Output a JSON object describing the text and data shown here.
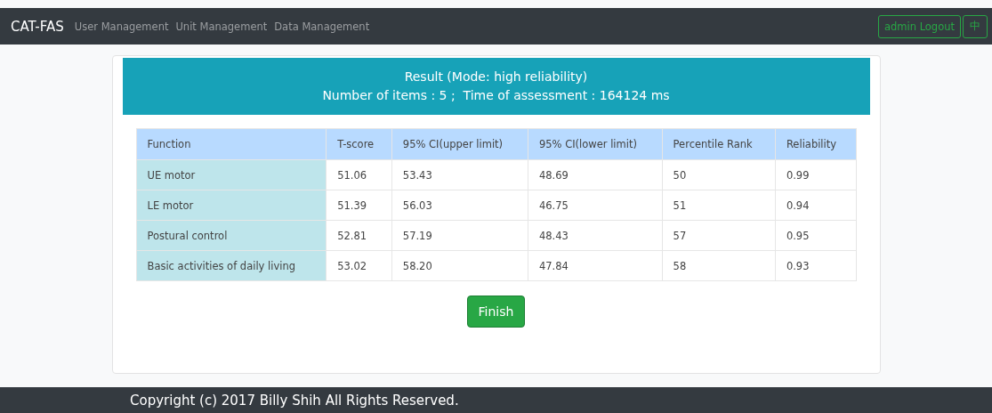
{
  "navbar": {
    "brand": "CAT-FAS",
    "links": [
      "User Management",
      "Unit Management",
      "Data Management"
    ],
    "buttons": [
      "admin Logout",
      "中"
    ]
  },
  "result": {
    "title": "Result (Mode: high reliability)",
    "summary": "Number of items : 5 ;  Time of assessment : 164124 ms"
  },
  "table": {
    "columns": [
      "Function",
      "T-score",
      "95% CI(upper limit)",
      "95% CI(lower limit)",
      "Percentile Rank",
      "Reliability"
    ],
    "rows": [
      [
        "UE motor",
        "51.06",
        "53.43",
        "48.69",
        "50",
        "0.99"
      ],
      [
        "LE motor",
        "51.39",
        "56.03",
        "46.75",
        "51",
        "0.94"
      ],
      [
        "Postural control",
        "52.81",
        "57.19",
        "48.43",
        "57",
        "0.95"
      ],
      [
        "Basic activities of daily living",
        "53.02",
        "58.20",
        "47.84",
        "58",
        "0.93"
      ]
    ]
  },
  "finish_button": "Finish",
  "footer": "Copyright (c) 2017 Billy Shih All Rights Reserved."
}
